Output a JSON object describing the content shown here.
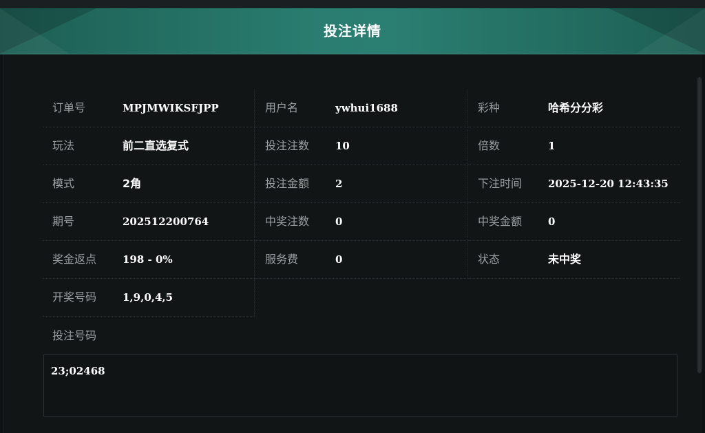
{
  "dialog": {
    "title": "投注详情"
  },
  "details": [
    {
      "label": "订单号",
      "value": "MPJMWIKSFJPP"
    },
    {
      "label": "用户名",
      "value": "ywhui1688"
    },
    {
      "label": "彩种",
      "value": "哈希分分彩"
    },
    {
      "label": "玩法",
      "value": "前二直选复式"
    },
    {
      "label": "投注注数",
      "value": "10"
    },
    {
      "label": "倍数",
      "value": "1"
    },
    {
      "label": "模式",
      "value": "2角"
    },
    {
      "label": "投注金额",
      "value": "2"
    },
    {
      "label": "下注时间",
      "value": "2025-12-20 12:43:35"
    },
    {
      "label": "期号",
      "value": "202512200764"
    },
    {
      "label": "中奖注数",
      "value": "0"
    },
    {
      "label": "中奖金额",
      "value": "0"
    },
    {
      "label": "奖金返点",
      "value": "198 - 0%"
    },
    {
      "label": "服务费",
      "value": "0"
    },
    {
      "label": "状态",
      "value": "未中奖"
    },
    {
      "label": "开奖号码",
      "value": "1,9,0,4,5"
    }
  ],
  "bet_numbers": {
    "label": "投注号码",
    "value": "23;02468"
  }
}
